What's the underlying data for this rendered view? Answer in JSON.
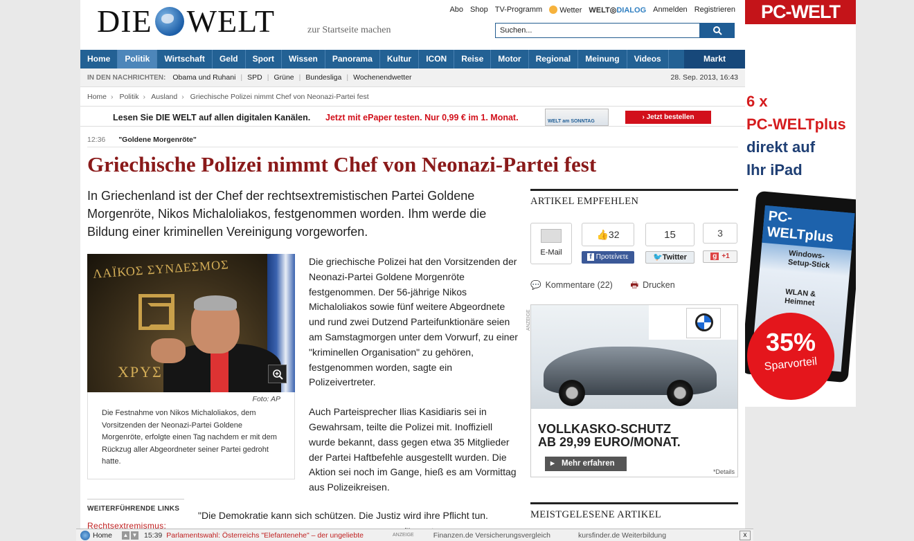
{
  "header": {
    "logo_left": "DIE",
    "logo_right": "WELT",
    "start_link": "zur Startseite machen",
    "toplinks": [
      "Abo",
      "Shop",
      "TV-Programm"
    ],
    "weather": "Wetter",
    "dialog_a": "WELT",
    "dialog_b": "DIALOG",
    "login": "Anmelden",
    "register": "Registrieren",
    "search_placeholder": "Suchen..."
  },
  "nav": {
    "items": [
      "Home",
      "Politik",
      "Wirtschaft",
      "Geld",
      "Sport",
      "Wissen",
      "Panorama",
      "Kultur",
      "ICON",
      "Reise",
      "Motor",
      "Regional",
      "Meinung",
      "Videos"
    ],
    "active": "Politik",
    "market": "Markt"
  },
  "news": {
    "label": "IN DEN NACHRICHTEN:",
    "items": [
      "Obama und Ruhani",
      "SPD",
      "Grüne",
      "Bundesliga",
      "Wochenendwetter"
    ],
    "date": "28. Sep. 2013, 16:43"
  },
  "breadcrumb": [
    "Home",
    "Politik",
    "Ausland",
    "Griechische Polizei nimmt Chef von Neonazi-Partei fest"
  ],
  "promo": {
    "text": "Lesen Sie DIE WELT auf allen digitalen Kanälen.",
    "offer": "Jetzt mit ePaper testen. Nur 0,99 € im 1. Monat.",
    "paper": "WELT am SONNTAG",
    "button": "› Jetzt bestellen"
  },
  "article": {
    "time": "12:36",
    "kicker": "\"Goldene Morgenröte\"",
    "title": "Griechische Polizei nimmt Chef von Neonazi-Partei fest",
    "lead": "In Griechenland ist der Chef der rechtsextremistischen Partei Goldene Morgenröte, Nikos Michaloliakos, festgenommen worden. Ihm werde die Bildung einer kriminellen Vereinigung vorgeworfen.",
    "photo_banner_top": "ΛΑΪΚΟΣ ΣΥΝΔΕΣΜΟΣ",
    "photo_banner_bottom": "ΧΡΥΣ",
    "photo_credit": "Foto: AP",
    "caption": "Die Festnahme von Nikos Michaloliakos, dem Vorsitzenden der Neonazi-Partei Goldene Morgenröte, erfolgte einen Tag nachdem er mit dem Rückzug aller Abgeordneter seiner Partei gedroht hatte.",
    "p1": "Die griechische Polizei hat den Vorsitzenden der Neonazi-Partei Goldene Morgenröte festgenommen. Der 56-jährige Nikos Michaloliakos sowie fünf weitere Abgeordnete und rund zwei Dutzend Parteifunktionäre seien am Samstagmorgen unter dem Vorwurf, zu einer \"kriminellen Organisation\" zu gehören, festgenommen worden, sagte ein Polizeivertreter.",
    "p2": "Auch Parteisprecher Ilias Kasidiaris sei in Gewahrsam, teilte die Polizei mit. Inoffiziell wurde bekannt, dass gegen etwa 35 Mitglieder der Partei Haftbefehle ausgestellt wurden. Die Aktion sei noch im Gange, hieß es am Vormittag aus Polizeikreisen.",
    "quote": "\"Die Demokratie kann sich schützen. Die Justiz wird ihre Pflicht tun.",
    "quote_cont": "nd\", sagte",
    "further_label": "WEITERFÜHRENDE LINKS",
    "further_link": "Rechtsextremismus:"
  },
  "sidebar": {
    "recommend": "ARTIKEL EMPFEHLEN",
    "email": "E-Mail",
    "fb_count": "32",
    "fb_btn": "Προτείνετε",
    "tw_count": "15",
    "tw_btn": "Twitter",
    "gp_count": "3",
    "gp_btn": "+1",
    "comments": "Kommentare (22)",
    "print": "Drucken",
    "ad_label": "ANZEIGE",
    "ad_line1": "VOLLKASKO-SCHUTZ",
    "ad_line2": "AB 29,99 EURO/MONAT.",
    "ad_more": "Mehr erfahren",
    "ad_details": "*Details",
    "mostread": "MEISTGELESENE ARTIKEL"
  },
  "banner": {
    "head": "PC-WELT",
    "l1": "6 x",
    "l2": "PC-WELTplus",
    "l3": "direkt auf",
    "l4": "Ihr iPad",
    "screen_title": "PC-WELTplus",
    "screen_l1": "Windows-Setup-Stick",
    "screen_l2": "WLAN & Heimnet",
    "pct": "35%",
    "save": "Sparvorteil",
    "l2_color": "#d51c1e",
    "l3_color": "#1f3f74"
  },
  "bottombar": {
    "home": "Home",
    "time": "15:39",
    "headline": "Parlamentswahl: Österreichs \"Elefantenehe\" – der ungeliebte",
    "anz": "ANZEIGE",
    "l2": "Finanzen.de Versicherungsvergleich",
    "l3": "kursfinder.de Weiterbildung",
    "close": "x"
  }
}
